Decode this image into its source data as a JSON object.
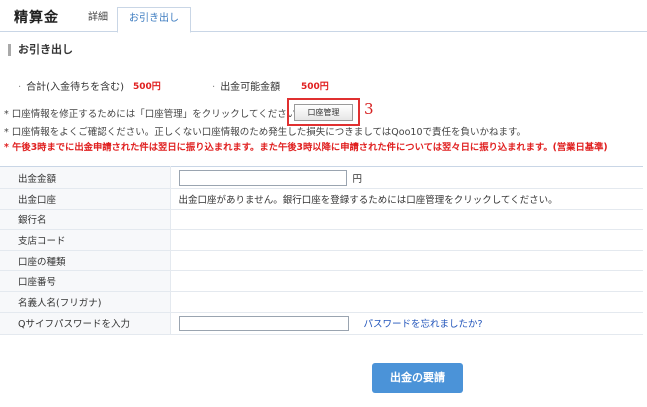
{
  "header": {
    "title": "精算金",
    "tabs": [
      {
        "label": "詳細"
      },
      {
        "label": "お引き出し"
      }
    ]
  },
  "section": {
    "title": "お引き出し"
  },
  "summary": {
    "total_label": "合計(入金待ちを含む)",
    "total_value": "500円",
    "available_label": "出金可能金額",
    "available_value": "500円"
  },
  "notes": {
    "note1": "* 口座情報を修正するためには「口座管理」をクリックしてください。",
    "note2": "* 口座情報をよくご確認ください。正しくない口座情報のため発生した損失につきましてはQoo10で責任を負いかねます。",
    "note3": "* 午後3時までに出金申請された件は翌日に振り込まれます。また午後3時以降に申請された件については翌々日に振り込まれます。(営業日基準)"
  },
  "account_mgmt_button": {
    "label": "口座管理"
  },
  "annotation": {
    "number": "3"
  },
  "form": {
    "rows": [
      {
        "label": "出金金額",
        "suffix": "円"
      },
      {
        "label": "出金口座",
        "value": "出金口座がありません。銀行口座を登録するためには口座管理をクリックしてください。"
      },
      {
        "label": "銀行名",
        "value": ""
      },
      {
        "label": "支店コード",
        "value": ""
      },
      {
        "label": "口座の種類",
        "value": ""
      },
      {
        "label": "口座番号",
        "value": ""
      },
      {
        "label": "名義人名(フリガナ)",
        "value": ""
      },
      {
        "label": "Qサイフパスワードを入力"
      }
    ],
    "forgot_password_link": "パスワードを忘れましたか?"
  },
  "submit_button": {
    "label": "出金の要請"
  },
  "colors": {
    "accent_blue": "#4b93d8",
    "alert_red": "#e02020",
    "link_blue": "#2255bb"
  }
}
